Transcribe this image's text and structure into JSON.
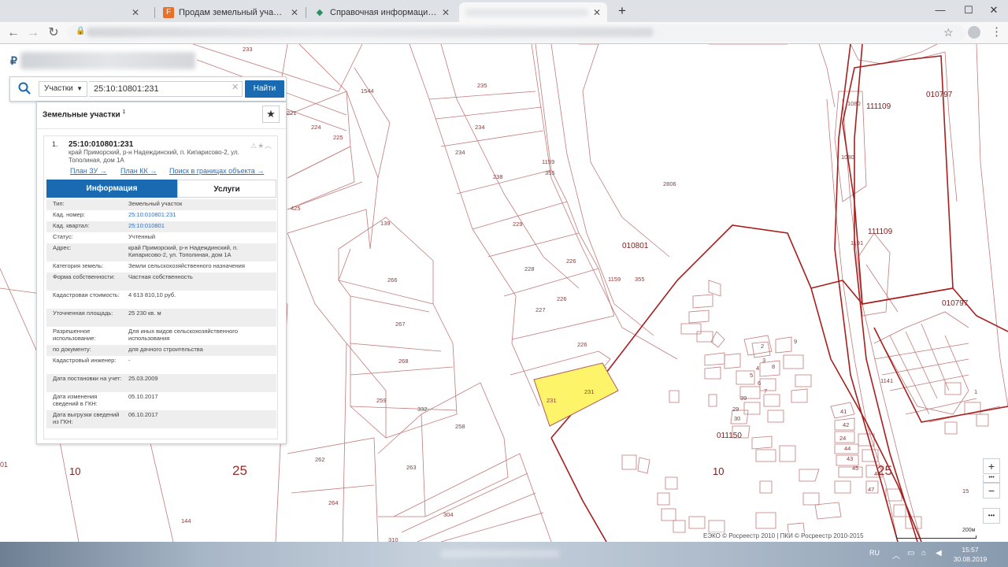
{
  "browser": {
    "tabs": [
      {
        "title": "",
        "favicon": "",
        "active": false
      },
      {
        "title": "Продам земельный участок в п",
        "favicon": "F",
        "active": false
      },
      {
        "title": "Справочная информация по об",
        "favicon": "◆",
        "active": false
      },
      {
        "title": "",
        "favicon": "",
        "active": true
      }
    ],
    "new_tab": "+",
    "window_controls": {
      "minimize": "—",
      "maximize": "☐",
      "close": "✕"
    }
  },
  "search": {
    "type_label": "Участки",
    "value": "25:10:10801:231",
    "clear": "✕",
    "button_label": "Найти"
  },
  "panel": {
    "title": "Земельные участки",
    "title_sup": "1",
    "fav_icon": "★",
    "card": {
      "number": "1.",
      "cadnum": "25:10:010801:231",
      "address": "край Приморский, р-н Надеждинский, п. Кипарисово-2, ул. Тополиная, дом 1А",
      "links": [
        "План ЗУ →",
        "План КК →",
        "Поиск в границах объекта →"
      ],
      "tabs": {
        "info": "Информация",
        "services": "Услуги"
      },
      "rows": [
        {
          "k": "Тип:",
          "v": "Земельный участок"
        },
        {
          "k": "Кад. номер:",
          "v": "25:10:010801:231"
        },
        {
          "k": "Кад. квартал:",
          "v": "25:10:010801"
        },
        {
          "k": "Статус:",
          "v": "Учтенный"
        },
        {
          "k": "Адрес:",
          "v": "край Приморский, р-н Надеждинский, п. Кипарисово-2, ул. Тополиная, дом 1А"
        },
        {
          "k": "Категория земель:",
          "v": "Земли сельскохозяйственного назначения"
        },
        {
          "k": "Форма собственности:",
          "v": "Частная собственность"
        },
        {
          "k": "Кадастровая стоимость:",
          "v": "4 613 810,10 руб."
        },
        {
          "k": "Уточненная площадь:",
          "v": "25 230 кв. м"
        },
        {
          "k": "Разрешенное использование:",
          "v": "Для иных видов сельскохозяйственного использования"
        },
        {
          "k": "по документу:",
          "v": "для дачного строительства"
        },
        {
          "k": "Кадастровый инженер:",
          "v": "-"
        },
        {
          "k": "Дата постановки на учет:",
          "v": "25.03.2009"
        },
        {
          "k": "Дата изменения сведений в ГКН:",
          "v": "05.10.2017"
        },
        {
          "k": "Дата выгрузки сведений из ГКН:",
          "v": "06.10.2017"
        }
      ]
    }
  },
  "map": {
    "plots": [
      "233",
      "235",
      "234",
      "234",
      "238",
      "229",
      "228",
      "227",
      "226",
      "226",
      "231",
      "231",
      "224",
      "225",
      "221",
      "1544",
      "425",
      "139",
      "266",
      "267",
      "268",
      "259",
      "262",
      "264",
      "263",
      "258",
      "332",
      "304",
      "310",
      "144",
      "1159",
      "355",
      "1159",
      "355",
      "2806",
      "226",
      "1080",
      "1080",
      "1191",
      "1141",
      "15",
      "1",
      "2",
      "3",
      "4",
      "5",
      "6",
      "7",
      "8",
      "9",
      "39",
      "29",
      "30",
      "41",
      "42",
      "24",
      "44",
      "43",
      "45",
      "46",
      "47"
    ],
    "quarters": [
      "010801",
      "111109",
      "111109",
      "010797",
      "010797",
      "011150"
    ],
    "big_numbers": [
      "25",
      "25"
    ],
    "mid_numbers": [
      "10",
      "10"
    ],
    "edge_number": "01",
    "attribution": "ЕЭКО © Росреестр 2010 | ПКИ © Росреестр 2010-2015",
    "scale_label": "200м",
    "zoom_in": "+",
    "zoom_out": "−",
    "more": "•••",
    "colors": {
      "highlight": "#fef46a",
      "parcel_line": "#b55a5a",
      "quarter_line": "#9e1b1b"
    }
  },
  "taskbar": {
    "lang": "RU",
    "time": "15:57",
    "date": "30.08.2019"
  }
}
